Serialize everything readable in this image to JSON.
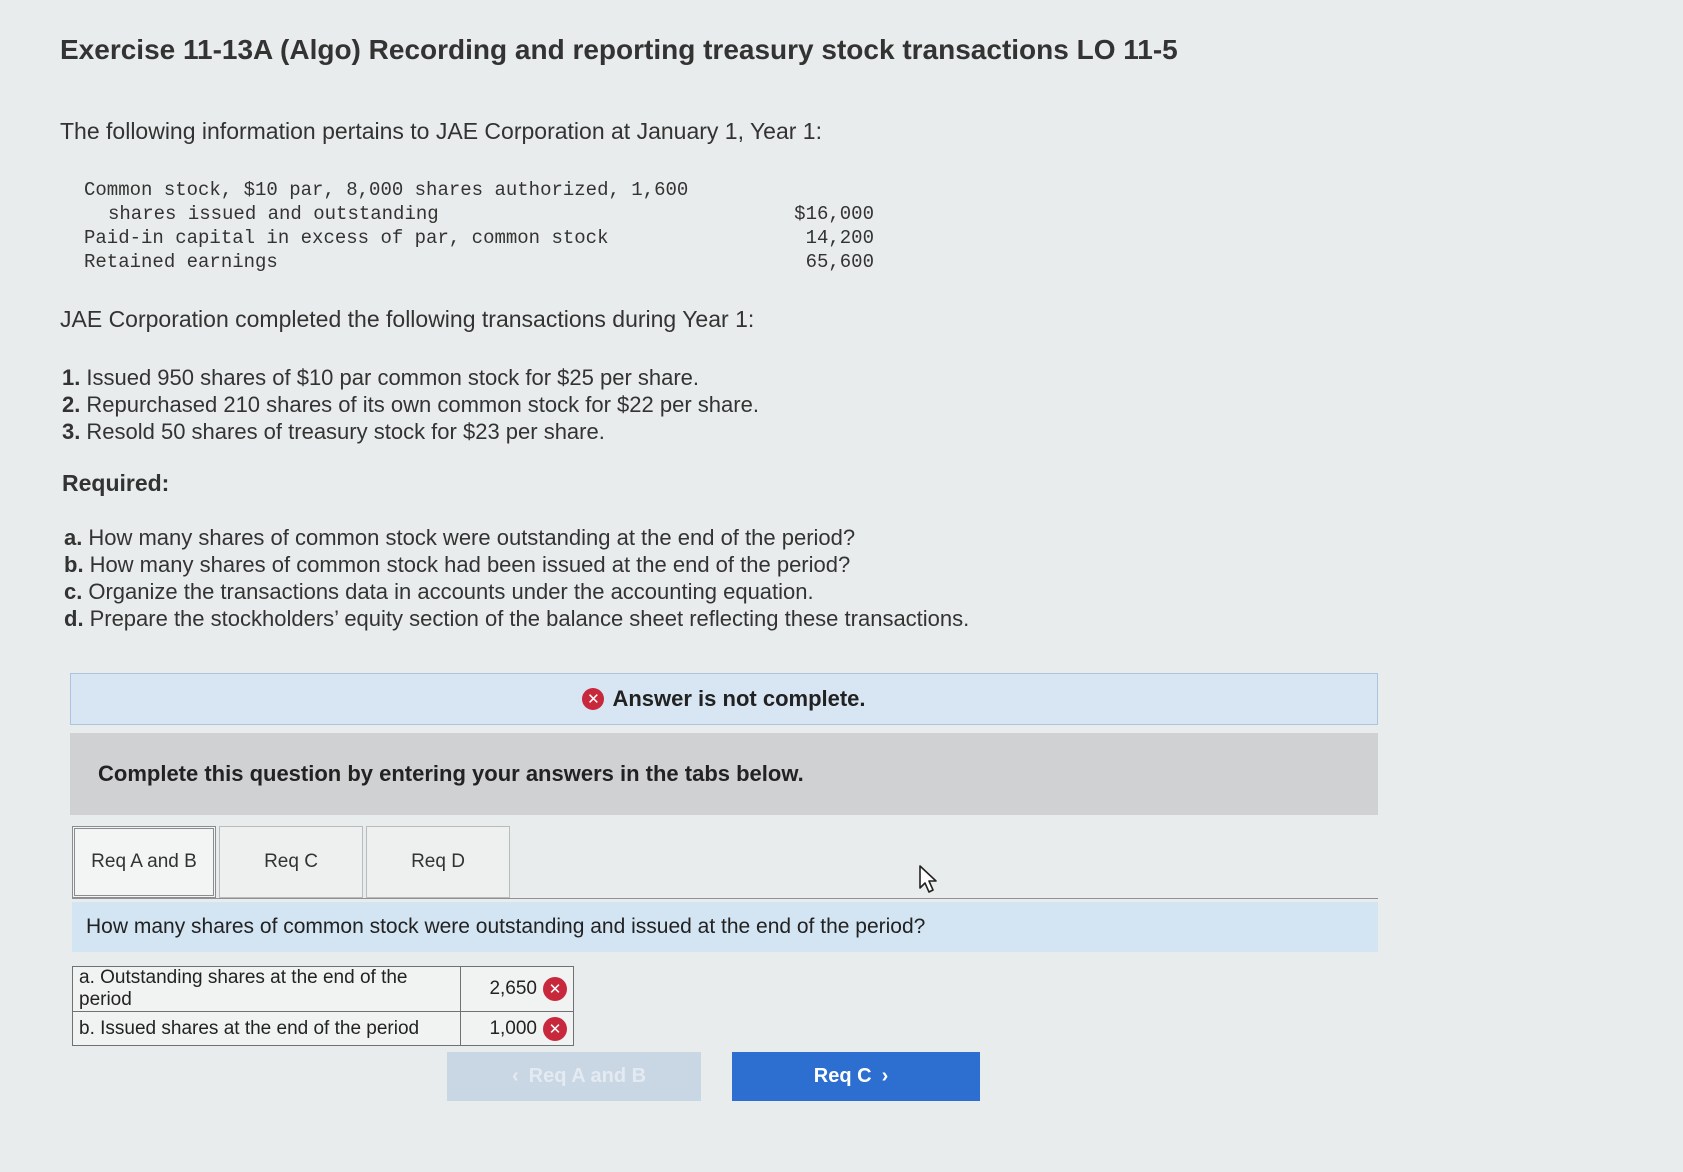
{
  "title": "Exercise 11-13A (Algo) Recording and reporting treasury stock transactions LO 11-5",
  "intro": "The following information pertains to JAE Corporation at January 1, Year 1:",
  "ledger": [
    {
      "label": "Common stock, $10 par, 8,000 shares authorized, 1,600",
      "amount": ""
    },
    {
      "label": "shares issued and outstanding",
      "amount": "$16,000"
    },
    {
      "label": "Paid-in capital in excess of par, common stock",
      "amount": "14,200"
    },
    {
      "label": "Retained earnings",
      "amount": "65,600"
    }
  ],
  "transactions_intro": "JAE Corporation completed the following transactions during Year 1:",
  "transactions": [
    {
      "num": "1.",
      "text": "Issued 950 shares of $10 par common stock for $25 per share."
    },
    {
      "num": "2.",
      "text": "Repurchased 210 shares of its own common stock for $22 per share."
    },
    {
      "num": "3.",
      "text": "Resold 50 shares of treasury stock for $23 per share."
    }
  ],
  "required_label": "Required:",
  "requirements": [
    {
      "letter": "a.",
      "text": "How many shares of common stock were outstanding at the end of the period?"
    },
    {
      "letter": "b.",
      "text": "How many shares of common stock had been issued at the end of the period?"
    },
    {
      "letter": "c.",
      "text": "Organize the transactions data in accounts under the accounting equation."
    },
    {
      "letter": "d.",
      "text": "Prepare the stockholders’ equity section of the balance sheet reflecting these transactions."
    }
  ],
  "status": {
    "icon": "x-circle-icon",
    "text": "Answer is not complete.",
    "color": "#c8283c"
  },
  "instruction": "Complete this question by entering your answers in the tabs below.",
  "tabs": [
    {
      "label": "Req A and B",
      "active": true
    },
    {
      "label": "Req C",
      "active": false
    },
    {
      "label": "Req D",
      "active": false
    }
  ],
  "question": "How many shares of common stock were outstanding and issued at the end of the period?",
  "answers": [
    {
      "label": "a. Outstanding shares at the end of the period",
      "value": "2,650",
      "status": "incorrect"
    },
    {
      "label": "b. Issued shares at the end of the period",
      "value": "1,000",
      "status": "incorrect"
    }
  ],
  "nav": {
    "prev_label": "Req A and B",
    "next_label": "Req C",
    "prev_enabled": false,
    "accent": "#2c6fd1"
  }
}
